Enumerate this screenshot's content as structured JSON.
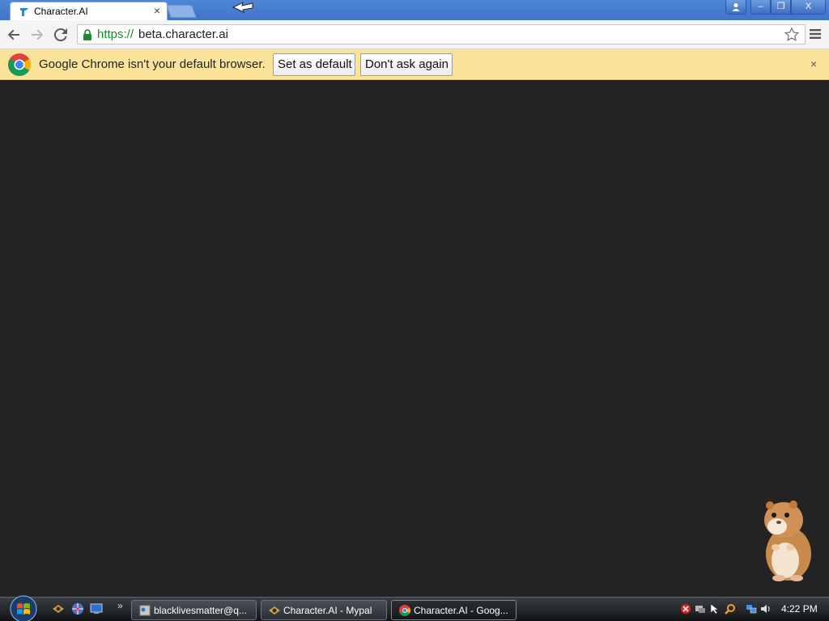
{
  "window": {
    "tabs": [
      {
        "title": "Character.AI",
        "close_glyph": "×",
        "icon": "character-ai-favicon"
      }
    ],
    "controls": {
      "user": "user-icon",
      "minimize": "–",
      "maximize": "❐",
      "close": "X"
    }
  },
  "toolbar": {
    "url_scheme": "https://",
    "url_host": "beta.character.ai",
    "icons": [
      "back-arrow-icon",
      "forward-arrow-icon",
      "reload-icon",
      "lock-icon",
      "star-icon",
      "menu-icon"
    ]
  },
  "infobar": {
    "message": "Google Chrome isn't your default browser.",
    "set_default_label": "Set as default",
    "dont_ask_label": "Don't ask again",
    "close_glyph": "×"
  },
  "taskbar": {
    "quick_launch_more": "»",
    "tasks": [
      {
        "label": "blacklivesmatter@q...",
        "icon": "messenger-icon"
      },
      {
        "label": "Character.AI - Mypal",
        "icon": "mypal-icon"
      },
      {
        "label": "Character.AI - Goog...",
        "icon": "chrome-icon",
        "active": true
      }
    ],
    "clock": "4:22 PM"
  },
  "colors": {
    "page_background": "#232323",
    "infobar": "#fbe49a",
    "titlebar": "#4f86d8",
    "secure_scheme": "#1a8a2e"
  }
}
